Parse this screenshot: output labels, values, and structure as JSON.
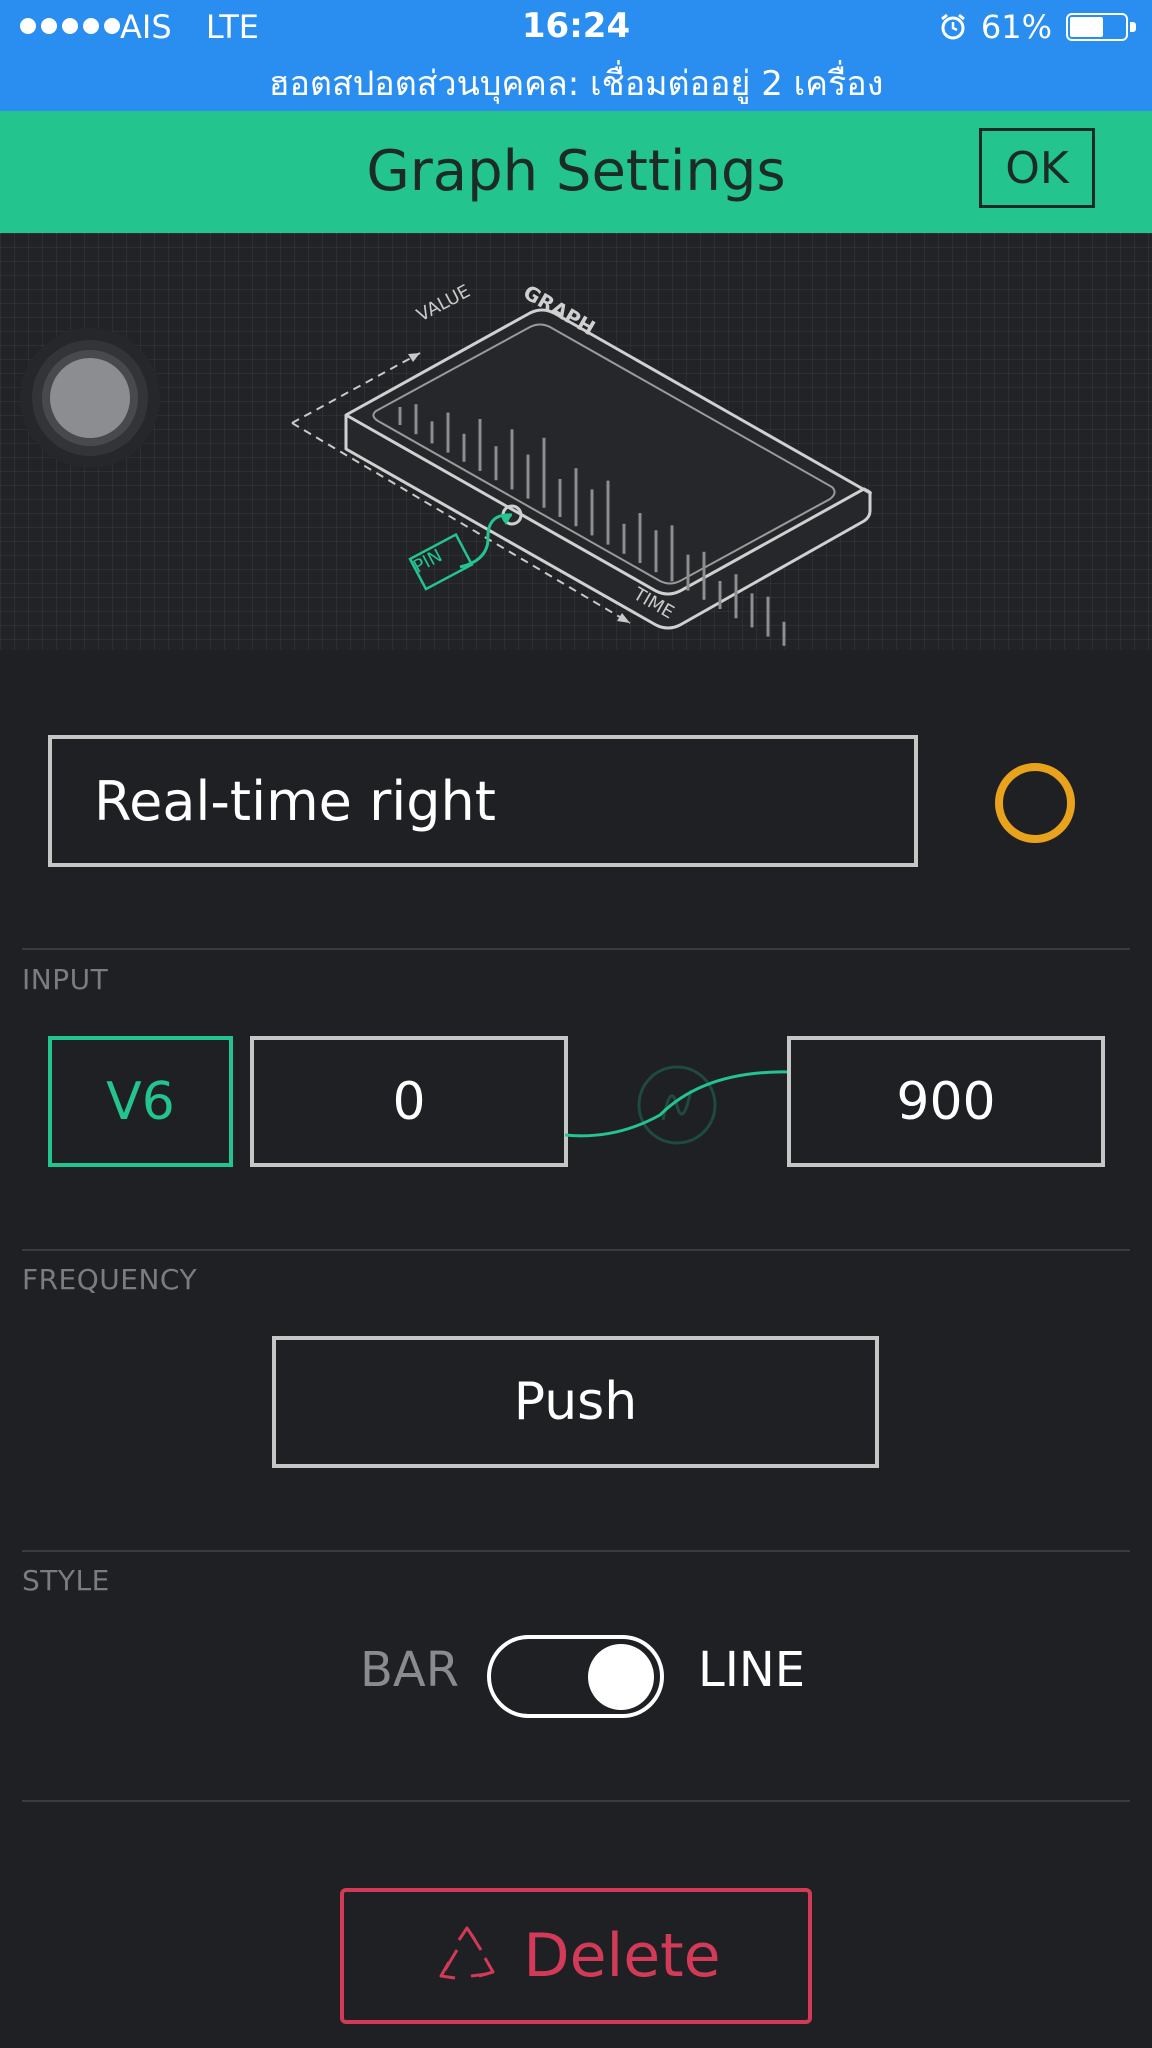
{
  "status_bar": {
    "carrier": "AIS",
    "network": "LTE",
    "time": "16:24",
    "battery": "61%",
    "battery_level": 0.61,
    "hotspot_text": "ฮอตสปอตส่วนบุคคล: เชื่อมต่ออยู่ 2 เครื่อง",
    "color": "#2a8df0"
  },
  "header": {
    "title": "Graph Settings",
    "ok_label": "OK",
    "color": "#23c48e"
  },
  "illustration": {
    "value_label": "VALUE",
    "graph_label": "GRAPH",
    "time_label": "TIME",
    "pin_label": "PIN"
  },
  "widget": {
    "name_value": "Real-time right",
    "color": "#e8a21b"
  },
  "input": {
    "section_label": "INPUT",
    "pin": "V6",
    "min": "0",
    "max": "900"
  },
  "frequency": {
    "section_label": "FREQUENCY",
    "value": "Push"
  },
  "style": {
    "section_label": "STYLE",
    "bar_label": "BAR",
    "line_label": "LINE",
    "selected": "LINE"
  },
  "delete": {
    "label": "Delete",
    "color": "#d33a57"
  },
  "icons": {
    "alarm": "alarm-icon",
    "battery": "battery-icon",
    "recycle": "recycle-icon",
    "drag": "drag-handle-icon"
  }
}
